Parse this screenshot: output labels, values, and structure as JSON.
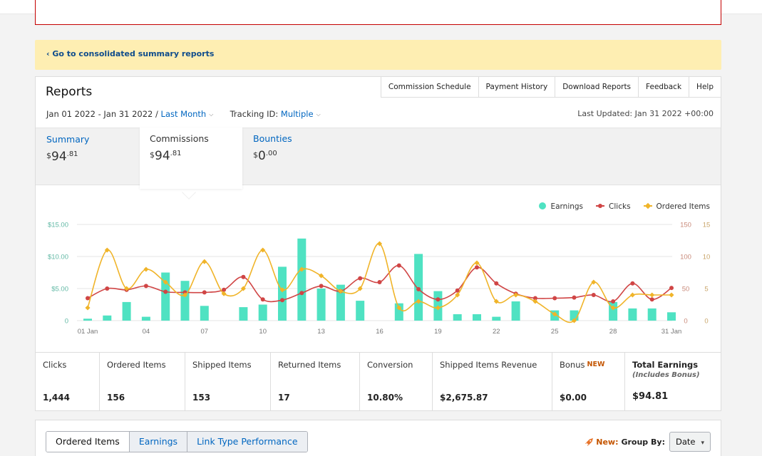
{
  "notice": {
    "link": "‹ Go to consolidated summary reports"
  },
  "reports": {
    "title": "Reports",
    "tabs": [
      "Commission Schedule",
      "Payment History",
      "Download Reports",
      "Feedback",
      "Help"
    ],
    "date_range": "Jan 01 2022 - Jan 31 2022 /",
    "period": "Last Month",
    "tracking_label": "Tracking ID:",
    "tracking_value": "Multiple",
    "last_updated": "Last Updated: Jan 31 2022 +00:00"
  },
  "summary": [
    {
      "label": "Summary",
      "dollars": "94",
      "cents": ".81",
      "currency": "$"
    },
    {
      "label": "Commissions",
      "dollars": "94",
      "cents": ".81",
      "currency": "$"
    },
    {
      "label": "Bounties",
      "dollars": "0",
      "cents": ".00",
      "currency": "$"
    }
  ],
  "legend": {
    "earnings": "Earnings",
    "clicks": "Clicks",
    "ordered": "Ordered Items"
  },
  "colors": {
    "earnings": "#4fe2c2",
    "clicks": "#d04545",
    "ordered": "#f0b429",
    "link": "#0066c0",
    "new": "#c45500"
  },
  "chart_data": {
    "type": "bar",
    "x_tick_labels": [
      "01 Jan",
      "04",
      "07",
      "10",
      "13",
      "16",
      "19",
      "22",
      "25",
      "28",
      "31 Jan"
    ],
    "left_axis": {
      "ticks": [
        "$15.00",
        "$10.00",
        "$5.00",
        "0"
      ],
      "ylim": [
        0,
        15
      ]
    },
    "right_axis_1": {
      "ticks": [
        "150",
        "100",
        "50",
        "0"
      ],
      "ylim": [
        0,
        150
      ]
    },
    "right_axis_2": {
      "ticks": [
        "15",
        "10",
        "5",
        "0"
      ],
      "ylim": [
        0,
        15
      ]
    },
    "days": [
      1,
      2,
      3,
      4,
      5,
      6,
      7,
      8,
      9,
      10,
      11,
      12,
      13,
      14,
      15,
      16,
      17,
      18,
      19,
      20,
      21,
      22,
      23,
      24,
      25,
      26,
      27,
      28,
      29,
      30,
      31
    ],
    "series": [
      {
        "name": "Earnings",
        "type": "bar",
        "axis": "left",
        "values": [
          0.3,
          0.8,
          2.9,
          0.6,
          7.5,
          6.2,
          2.3,
          0,
          2.1,
          2.5,
          8.4,
          12.8,
          5,
          5.6,
          3.1,
          0,
          2.7,
          10.4,
          4.6,
          1,
          1,
          0.6,
          3,
          0,
          1.6,
          1.6,
          0,
          2.9,
          1.9,
          1.9,
          1.3
        ]
      },
      {
        "name": "Clicks",
        "type": "line",
        "axis": "right1",
        "values": [
          35,
          50,
          48,
          54,
          45,
          44,
          44,
          48,
          68,
          33,
          32,
          43,
          54,
          46,
          66,
          60,
          86,
          49,
          33,
          47,
          83,
          58,
          42,
          35,
          35,
          36,
          40,
          30,
          58,
          33,
          51
        ]
      },
      {
        "name": "Ordered Items",
        "type": "line",
        "axis": "right2",
        "values": [
          2,
          11,
          5,
          8,
          6,
          4,
          9.2,
          4.2,
          5,
          11,
          4.8,
          8,
          7,
          4.6,
          5,
          12,
          2,
          3,
          2,
          4,
          9,
          3,
          4,
          3,
          1,
          0,
          6,
          2,
          4,
          4,
          4
        ]
      }
    ]
  },
  "stats": [
    {
      "label": "Clicks",
      "value": "1,444"
    },
    {
      "label": "Ordered Items",
      "value": "156"
    },
    {
      "label": "Shipped Items",
      "value": "153"
    },
    {
      "label": "Returned Items",
      "value": "17"
    },
    {
      "label": "Conversion",
      "value": "10.80%"
    },
    {
      "label": "Shipped Items Revenue",
      "value": "$2,675.87"
    },
    {
      "label": "Bonus",
      "badge": "NEW",
      "value": "$0.00"
    }
  ],
  "total": {
    "label": "Total Earnings",
    "sub": "(Includes Bonus)",
    "value": "$94.81"
  },
  "bottom": {
    "tabs": [
      "Ordered Items",
      "Earnings",
      "Link Type Performance"
    ],
    "new_label": "New:",
    "group_by_label": "Group By:",
    "group_by_value": "Date"
  }
}
